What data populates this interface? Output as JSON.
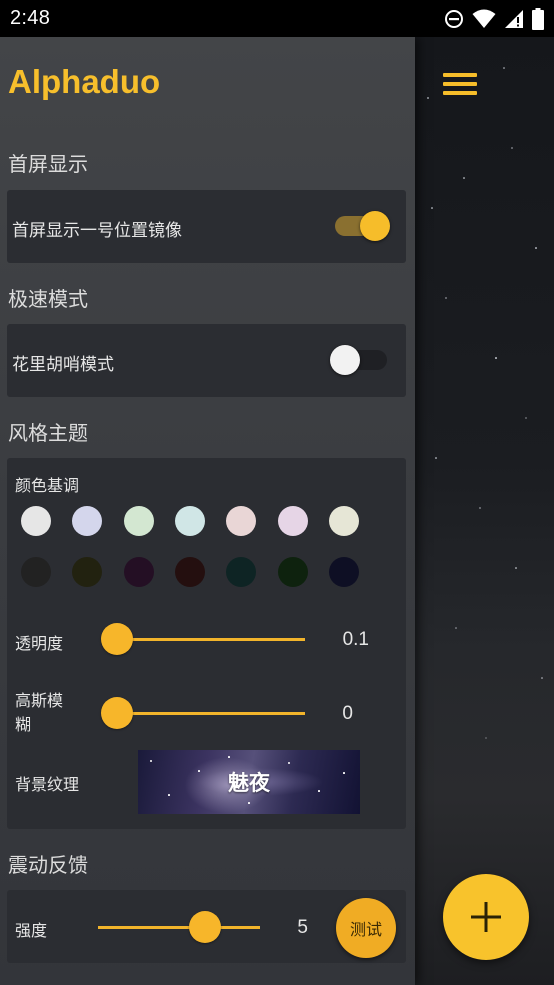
{
  "status_bar": {
    "time": "2:48",
    "icons": [
      "do-not-disturb-icon",
      "wifi-icon",
      "signal-icon",
      "battery-icon"
    ]
  },
  "app": {
    "title": "Alphaduo",
    "accent_color": "#f7bf2c"
  },
  "sections": {
    "home_display": {
      "title": "首屏显示",
      "toggle_label": "首屏显示一号位置镜像",
      "toggle_on": true
    },
    "speed_mode": {
      "title": "极速模式",
      "toggle_label": "花里胡哨模式",
      "toggle_on": false
    },
    "theme": {
      "title": "风格主题",
      "color_tone_label": "颜色基调",
      "light_colors": [
        "#e6e6e6",
        "#d4d6ec",
        "#d3e7d1",
        "#d0e6e6",
        "#e9d6d6",
        "#e6d5e6",
        "#e6e6d6"
      ],
      "dark_colors": [
        "#222222",
        "#222210",
        "#240f24",
        "#240f0f",
        "#0e2424",
        "#0e220e",
        "#0e0f24"
      ],
      "transparency": {
        "label": "透明度",
        "value": "0.1",
        "fraction": 0.0
      },
      "blur": {
        "label": "高斯模\n糊",
        "value": "0",
        "fraction": 0.0
      },
      "background_texture": {
        "label": "背景纹理",
        "value": "魅夜"
      }
    },
    "vibration": {
      "title": "震动反馈",
      "strength": {
        "label": "强度",
        "value": "5",
        "fraction": 0.67
      },
      "test_button": "测试"
    }
  },
  "toolbar": {
    "menu_icon": "hamburger-menu-icon",
    "fab_icon": "plus-icon"
  }
}
